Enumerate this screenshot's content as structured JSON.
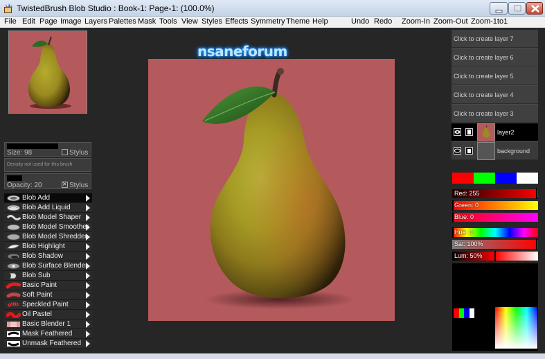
{
  "window": {
    "title": "TwistedBrush Blob Studio : Book-1: Page-1:  (100.0%)"
  },
  "menu": {
    "left": [
      "File",
      "Edit",
      "Page",
      "Image",
      "Layers",
      "Palettes",
      "Mask",
      "Tools",
      "View",
      "Styles",
      "Effects",
      "Symmetry",
      "Theme",
      "Help"
    ],
    "right": [
      "Undo",
      "Redo",
      "Zoom-In",
      "Zoom-Out",
      "Zoom-1to1"
    ]
  },
  "brush_controls": {
    "size_label": "Size: 98",
    "size_value": 98,
    "stylus_label": "Stylus",
    "size_stylus_checked": false,
    "density_note": "Density not used for this brush",
    "opacity_label": "Opacity: 20",
    "opacity_value": 20,
    "opacity_stylus_checked": true
  },
  "brushes": [
    {
      "label": "Blob Add",
      "icon": "blob-add-icon",
      "selected": true
    },
    {
      "label": "Blob Add Liquid",
      "icon": "blob-add-liquid-icon",
      "selected": false
    },
    {
      "label": "Blob Model Shaper",
      "icon": "blob-model-shaper-icon",
      "selected": false
    },
    {
      "label": "Blob Model Smoother",
      "icon": "blob-model-smoother-icon",
      "selected": false
    },
    {
      "label": "Blob Model Shredder",
      "icon": "blob-model-shredder-icon",
      "selected": false
    },
    {
      "label": "Blob Highlight",
      "icon": "blob-highlight-icon",
      "selected": false
    },
    {
      "label": "Blob Shadow",
      "icon": "blob-shadow-icon",
      "selected": false
    },
    {
      "label": "Blob Surface Blender",
      "icon": "blob-surface-blender-icon",
      "selected": false
    },
    {
      "label": "Blob Sub",
      "icon": "blob-sub-icon",
      "selected": false
    },
    {
      "label": "Basic Paint",
      "icon": "basic-paint-icon",
      "selected": false
    },
    {
      "label": "Soft Paint",
      "icon": "soft-paint-icon",
      "selected": false
    },
    {
      "label": "Speckled Paint",
      "icon": "speckled-paint-icon",
      "selected": false
    },
    {
      "label": "Oil Pastel",
      "icon": "oil-pastel-icon",
      "selected": false
    },
    {
      "label": "Basic Blender 1",
      "icon": "basic-blender-icon",
      "selected": false
    },
    {
      "label": "Mask Feathered",
      "icon": "mask-feathered-icon",
      "selected": false
    },
    {
      "label": "Unmask Feathered",
      "icon": "unmask-feathered-icon",
      "selected": false
    }
  ],
  "canvas": {
    "watermark": "nsaneforum",
    "background_color": "#b45a5c"
  },
  "layers": {
    "empty": [
      "Click to create layer 7",
      "Click to create layer 6",
      "Click to create layer 5",
      "Click to create layer 4",
      "Click to create layer 3"
    ],
    "layer2": "layer2",
    "background": "background"
  },
  "colors": {
    "swatches": [
      "#ff0000",
      "#00ff00",
      "#0000ff",
      "#ffffff"
    ],
    "red_label": "Red: 255",
    "green_label": "Green: 0",
    "blue_label": "Blue: 0",
    "hue_label": "Hue: 0",
    "sat_label": "Sat: 100%",
    "lum_label": "Lum: 50%",
    "red": 255,
    "green": 0,
    "blue": 0,
    "hue": 0,
    "sat": 100,
    "lum": 50,
    "current": "#ff0000"
  }
}
